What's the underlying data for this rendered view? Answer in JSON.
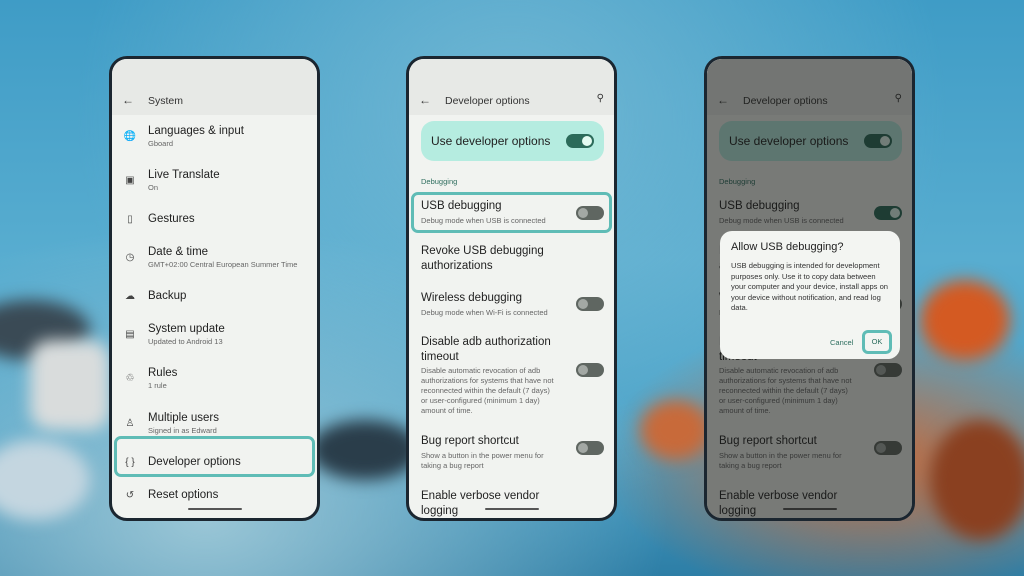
{
  "colors": {
    "accent": "#5fbcb6",
    "toggle_on": "#2c6b5a",
    "card": "#b5ece0"
  },
  "system": {
    "title": "System",
    "back_icon": "arrow-left",
    "items": [
      {
        "icon": "globe",
        "glyph": "🌐",
        "label": "Languages & input",
        "sub": "Gboard"
      },
      {
        "icon": "translate",
        "glyph": "▣",
        "label": "Live Translate",
        "sub": "On"
      },
      {
        "icon": "gestures",
        "glyph": "▯",
        "label": "Gestures",
        "sub": ""
      },
      {
        "icon": "clock",
        "glyph": "◷",
        "label": "Date & time",
        "sub": "GMT+02:00 Central European Summer Time"
      },
      {
        "icon": "cloud",
        "glyph": "☁",
        "label": "Backup",
        "sub": ""
      },
      {
        "icon": "system-update",
        "glyph": "▤",
        "label": "System update",
        "sub": "Updated to Android 13"
      },
      {
        "icon": "rules",
        "glyph": "♲",
        "label": "Rules",
        "sub": "1 rule"
      },
      {
        "icon": "person",
        "glyph": "♙",
        "label": "Multiple users",
        "sub": "Signed in as Edward"
      },
      {
        "icon": "braces",
        "glyph": "{ }",
        "label": "Developer options",
        "sub": "",
        "highlighted": true
      },
      {
        "icon": "history",
        "glyph": "↺",
        "label": "Reset options",
        "sub": ""
      }
    ]
  },
  "dev": {
    "title": "Developer options",
    "search_icon": "search",
    "master_label": "Use developer options",
    "master_on": true,
    "section": "Debugging",
    "items": [
      {
        "label": "USB debugging",
        "sub": "Debug mode when USB is connected",
        "toggle": true,
        "on": false,
        "highlighted": true
      },
      {
        "label": "Revoke USB debugging\nauthorizations",
        "sub": "",
        "toggle": false
      },
      {
        "label": "Wireless debugging",
        "sub": "Debug mode when Wi-Fi is connected",
        "toggle": true,
        "on": false
      },
      {
        "label": "Disable adb authorization\ntimeout",
        "sub": "Disable automatic revocation of adb\nauthorizations for systems that have not\nreconnected within the default (7 days)\nor user-configured (minimum 1 day)\namount of time.",
        "toggle": true,
        "on": false
      },
      {
        "label": "Bug report shortcut",
        "sub": "Show a button in the power menu for\ntaking a bug report",
        "toggle": true,
        "on": false
      },
      {
        "label": "Enable verbose vendor\nlogging",
        "sub": "",
        "toggle": false
      }
    ]
  },
  "dialog_screen": {
    "usb_debugging_on": true
  },
  "dialog": {
    "title": "Allow USB debugging?",
    "body": "USB debugging is intended for development purposes only. Use it to copy data between your computer and your device, install apps on your device without notification, and read log data.",
    "cancel": "Cancel",
    "ok": "OK"
  }
}
